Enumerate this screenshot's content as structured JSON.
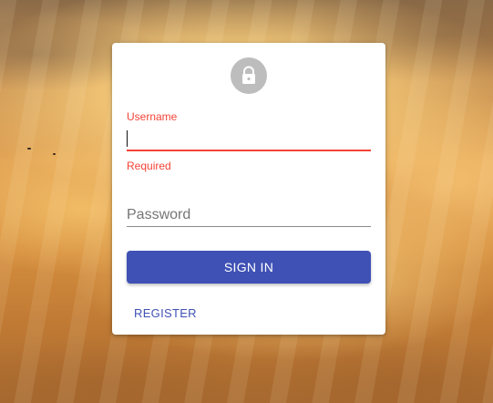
{
  "form": {
    "avatar_icon": "lock-icon",
    "username": {
      "label": "Username",
      "value": "",
      "helper": "Required"
    },
    "password": {
      "placeholder": "Password",
      "value": ""
    },
    "signin_label": "SIGN IN",
    "register_label": "REGISTER"
  },
  "colors": {
    "primary": "#3f51b5",
    "error": "#f44336",
    "avatar_bg": "#bdbdbd",
    "card_bg": "#ffffff"
  }
}
